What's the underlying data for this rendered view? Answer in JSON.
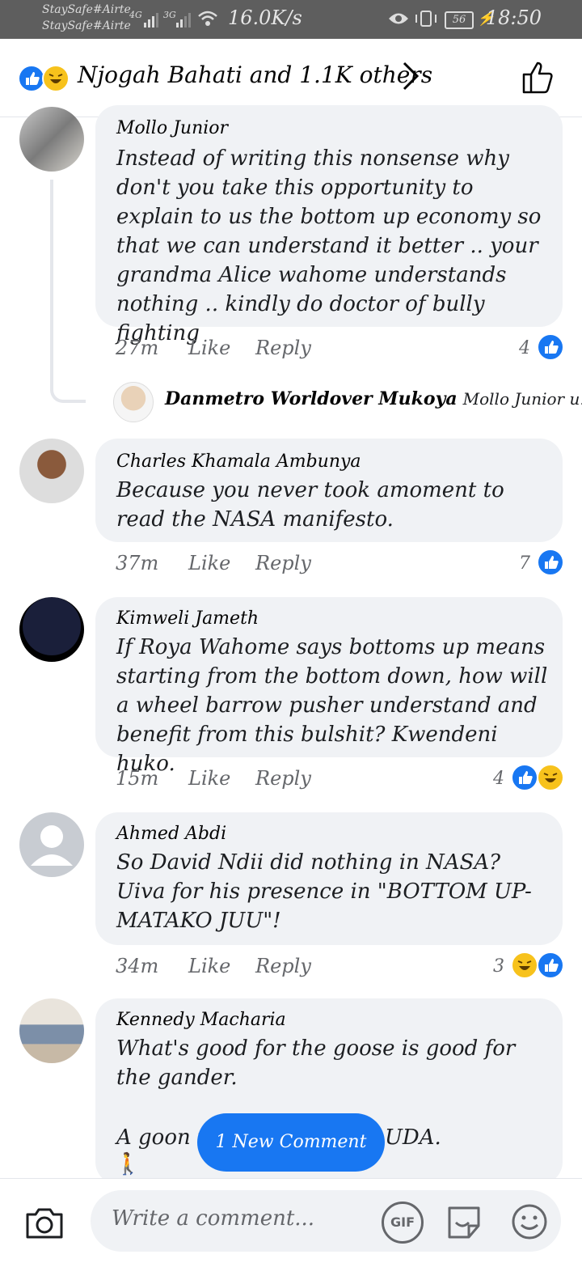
{
  "status_bar": {
    "carrier_1": "StaySafe#Airte",
    "carrier_2": "StaySafe#Airte",
    "net_1": "4G",
    "net_2": "3G",
    "speed": "16.0K/s",
    "battery": "56",
    "time": "18:50"
  },
  "header": {
    "reactions_text": "Njogah Bahati and 1.1K others"
  },
  "comments": [
    {
      "name": "Mollo Junior",
      "text": "Instead of writing this nonsense why don't you take this opportunity to explain to us the bottom up economy so that we can understand it better .. your grandma Alice wahome understands nothing .. kindly do doctor of bully fighting",
      "time": "27m",
      "like": "Like",
      "reply": "Reply",
      "reaction_count": "4"
    },
    {
      "name": "Charles Khamala Ambunya",
      "text": "Because you never took amoment to read the NASA manifesto.",
      "time": "37m",
      "like": "Like",
      "reply": "Reply",
      "reaction_count": "7"
    },
    {
      "name": "Kimweli Jameth",
      "text": "If Roya  Wahome says bottoms up  means starting from the bottom down, how will a wheel barrow pusher understand and benefit from this bulshit?  Kwendeni huko.",
      "time": "15m",
      "like": "Like",
      "reply": "Reply",
      "reaction_count": "4"
    },
    {
      "name": "Ahmed Abdi",
      "text": "So  David  Ndii did nothing in NASA? Uiva for his presence in \"BOTTOM UP- MATAKO JUU\"!",
      "time": "34m",
      "like": "Like",
      "reply": "Reply",
      "reaction_count": "3"
    },
    {
      "name": "Kennedy Macharia",
      "text_line1": "What's good for the goose is good for the gander.",
      "text_line2_start": "A goon i",
      "text_line2_end": "UDA."
    }
  ],
  "reply_preview": {
    "name": "Danmetro Worldover Mukoya",
    "snippet": "Mollo Junior u..."
  },
  "new_comment_label": "1 New Comment",
  "composer": {
    "placeholder": "Write a comment...",
    "gif_label": "GIF"
  }
}
